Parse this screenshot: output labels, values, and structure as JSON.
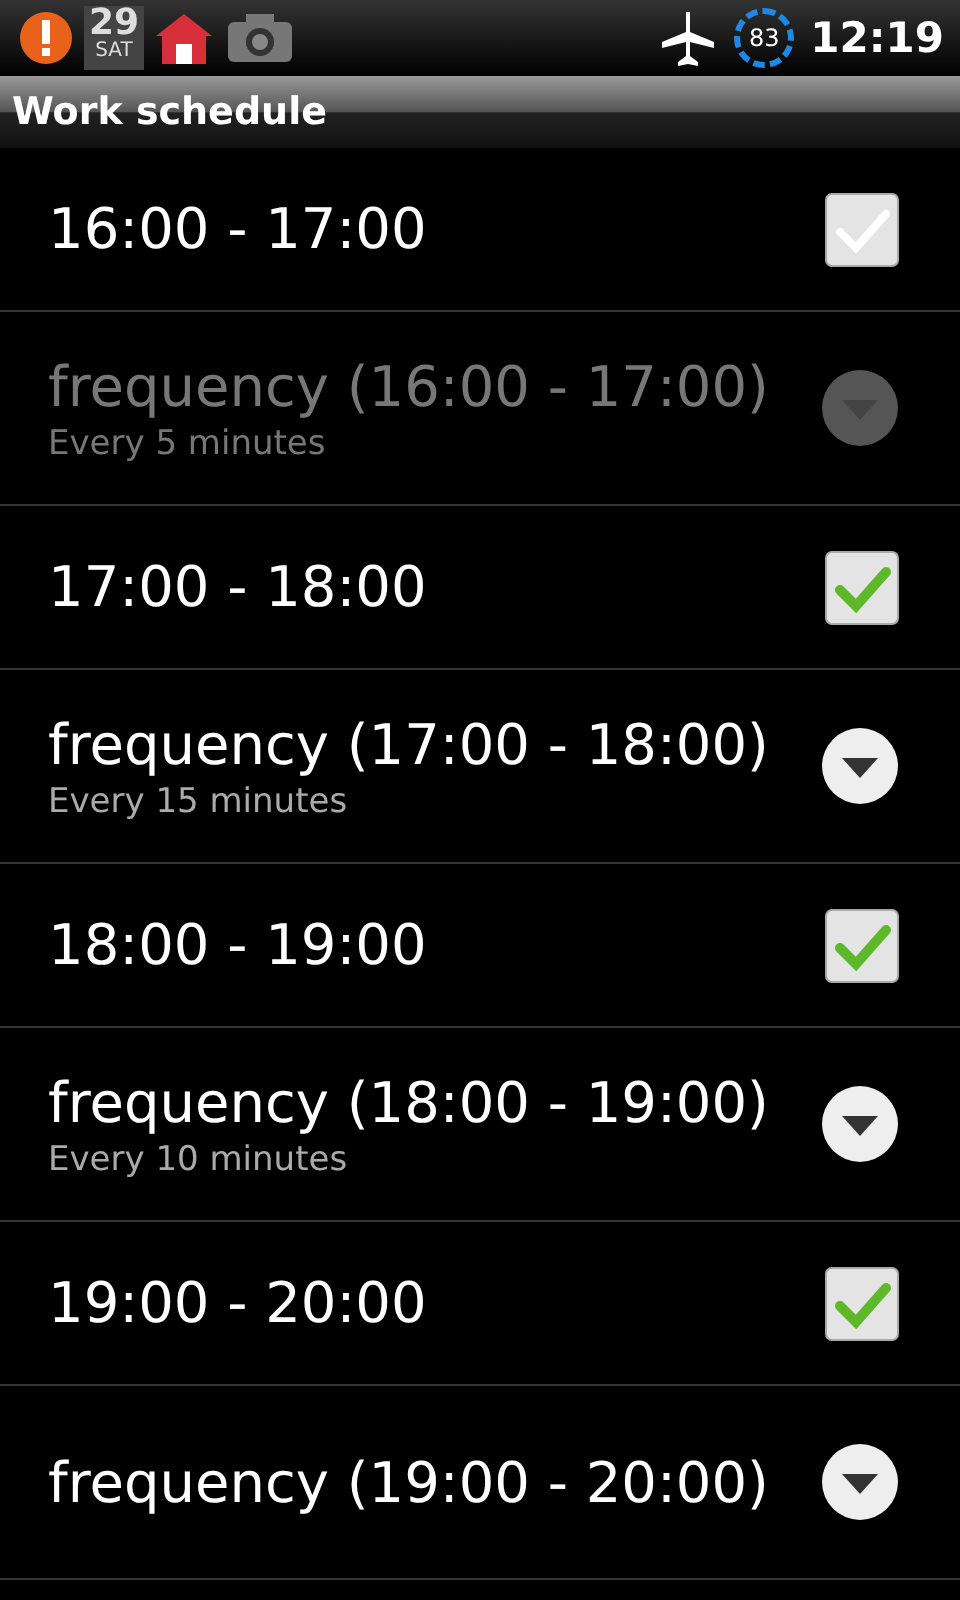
{
  "status_bar": {
    "calendar_day": "29",
    "calendar_weekday": "SAT",
    "battery": "83",
    "time": "12:19"
  },
  "title": "Work schedule",
  "items": [
    {
      "kind": "checkbox",
      "label": "16:00 - 17:00",
      "checked": false
    },
    {
      "kind": "list",
      "title": "frequency (16:00 - 17:00)",
      "summary": "Every 5 minutes",
      "disabled": true
    },
    {
      "kind": "checkbox",
      "label": "17:00 - 18:00",
      "checked": true
    },
    {
      "kind": "list",
      "title": "frequency (17:00 - 18:00)",
      "summary": "Every 15 minutes",
      "disabled": false
    },
    {
      "kind": "checkbox",
      "label": "18:00 - 19:00",
      "checked": true
    },
    {
      "kind": "list",
      "title": "frequency (18:00 - 19:00)",
      "summary": "Every 10 minutes",
      "disabled": false
    },
    {
      "kind": "checkbox",
      "label": "19:00 - 20:00",
      "checked": true
    },
    {
      "kind": "list",
      "title": "frequency (19:00 - 20:00)",
      "disabled": false
    }
  ]
}
